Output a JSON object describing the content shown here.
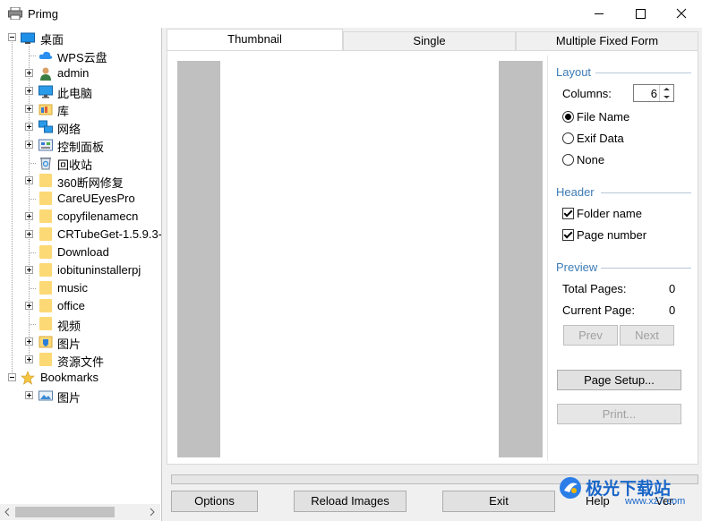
{
  "window": {
    "title": "Primg"
  },
  "tree": {
    "root": "桌面",
    "items": [
      {
        "label": "WPS云盘",
        "icon": "cloud-icon"
      },
      {
        "label": "admin",
        "icon": "user-icon"
      },
      {
        "label": "此电脑",
        "icon": "computer-icon"
      },
      {
        "label": "库",
        "icon": "library-icon"
      },
      {
        "label": "网络",
        "icon": "network-icon"
      },
      {
        "label": "控制面板",
        "icon": "control-panel-icon"
      },
      {
        "label": "回收站",
        "icon": "recycle-bin-icon"
      },
      {
        "label": "360断网修复",
        "icon": "folder-icon"
      },
      {
        "label": "CareUEyesPro",
        "icon": "folder-icon"
      },
      {
        "label": "copyfilenamecn",
        "icon": "folder-icon"
      },
      {
        "label": "CRTubeGet-1.5.9.3-",
        "icon": "folder-icon"
      },
      {
        "label": "Download",
        "icon": "folder-icon"
      },
      {
        "label": "iobituninstallerpj",
        "icon": "folder-icon"
      },
      {
        "label": "music",
        "icon": "folder-icon"
      },
      {
        "label": "office",
        "icon": "folder-icon"
      },
      {
        "label": "视频",
        "icon": "folder-icon"
      },
      {
        "label": "图片",
        "icon": "pictures-icon"
      },
      {
        "label": "资源文件",
        "icon": "folder-icon"
      }
    ],
    "bookmarks": "Bookmarks",
    "bookmark_items": [
      {
        "label": "图片"
      }
    ]
  },
  "tabs": [
    "Thumbnail",
    "Single",
    "Multiple Fixed Form"
  ],
  "layout": {
    "title": "Layout",
    "columns_label": "Columns:",
    "columns_value": "6",
    "radio_file_name": "File Name",
    "radio_exif": "Exif Data",
    "radio_none": "None",
    "selected": "File Name"
  },
  "header": {
    "title": "Header",
    "folder_name": "Folder name",
    "page_number": "Page number",
    "folder_name_checked": true,
    "page_number_checked": true
  },
  "preview": {
    "title": "Preview",
    "total_pages_label": "Total Pages:",
    "total_pages_value": "0",
    "current_page_label": "Current Page:",
    "current_page_value": "0",
    "prev": "Prev",
    "next": "Next",
    "page_setup": "Page Setup...",
    "print": "Print..."
  },
  "bottom": {
    "options": "Options",
    "reload": "Reload Images",
    "exit": "Exit",
    "help": "Help",
    "ver": "Ver."
  },
  "watermark": {
    "brand": "极光下载站",
    "url": "www.xz7.com"
  },
  "colors": {
    "group_title": "#3d7bb5",
    "folder": "#fcd975"
  }
}
